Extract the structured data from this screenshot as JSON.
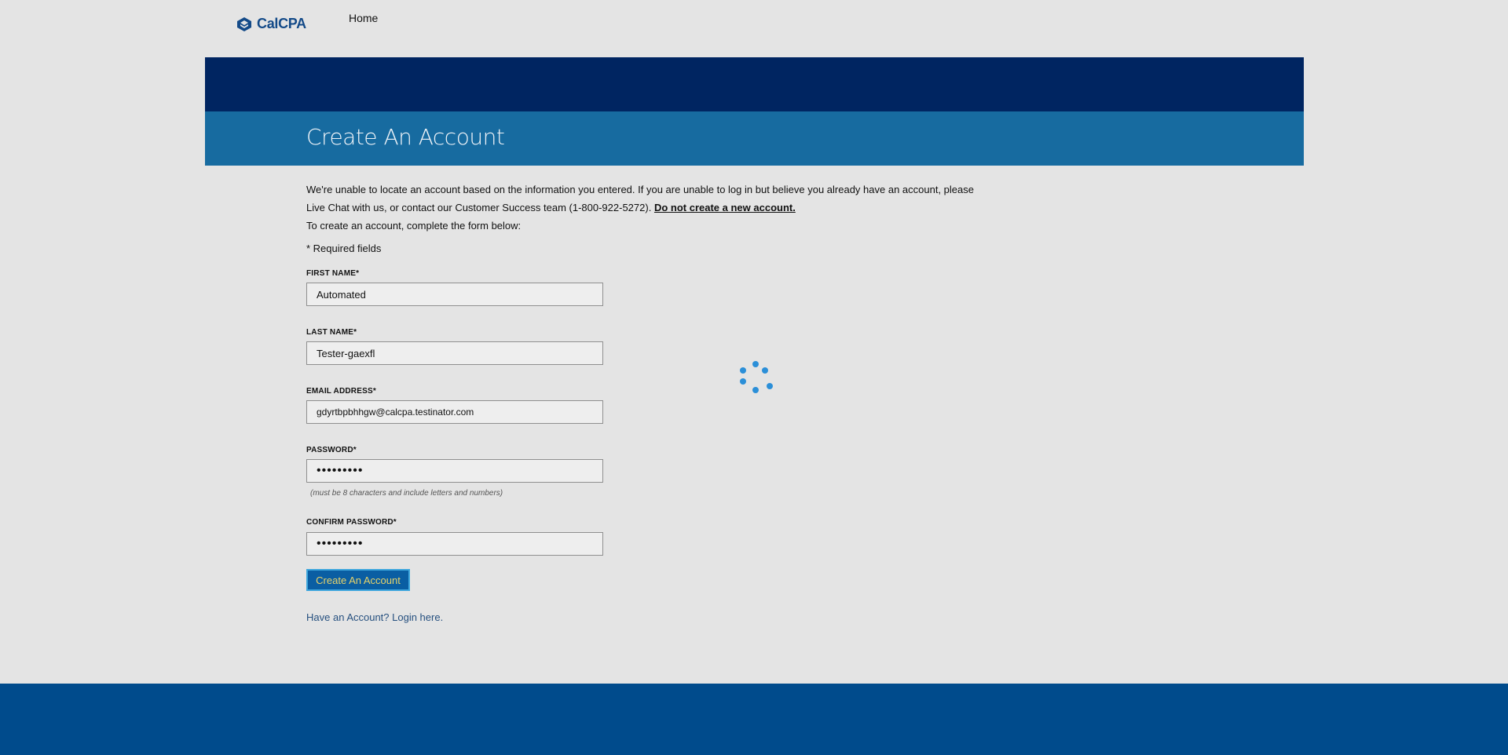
{
  "header": {
    "logo_text": "CalCPA",
    "nav_home": "Home"
  },
  "banner": {
    "title": "Create An Account"
  },
  "message": {
    "line1": "We're unable to locate an account based on the information you entered. If you are unable to log in but believe you already have an account, please",
    "line2": "Live Chat with us, or contact our Customer Success team (1-800-922-5272).",
    "warning": "Do not create a new account.",
    "line3": "To create an account, complete the form below:"
  },
  "form": {
    "required_note": "* Required fields",
    "first_name": {
      "label": "FIRST NAME*",
      "value": "Automated"
    },
    "last_name": {
      "label": "LAST NAME*",
      "value": "Tester-gaexfl"
    },
    "email": {
      "label": "EMAIL ADDRESS*",
      "value": "gdyrtbpbhhgw@calcpa.testinator.com"
    },
    "password": {
      "label": "PASSWORD*",
      "value": "•••••••••",
      "hint": "(must be 8 characters and include letters and numbers)"
    },
    "confirm_password": {
      "label": "CONFIRM PASSWORD*",
      "value": "•••••••••"
    },
    "submit_label": "Create An Account",
    "login_link": "Have an Account? Login here."
  },
  "colors": {
    "banner_dark": "#002561",
    "banner_light": "#176ba0",
    "footer": "#004b8c",
    "button": "#0a5ea3",
    "spinner": "#2b8fd8"
  },
  "icons": {
    "logo": "calcpa-logo-icon",
    "loading": "loading-spinner-icon"
  }
}
